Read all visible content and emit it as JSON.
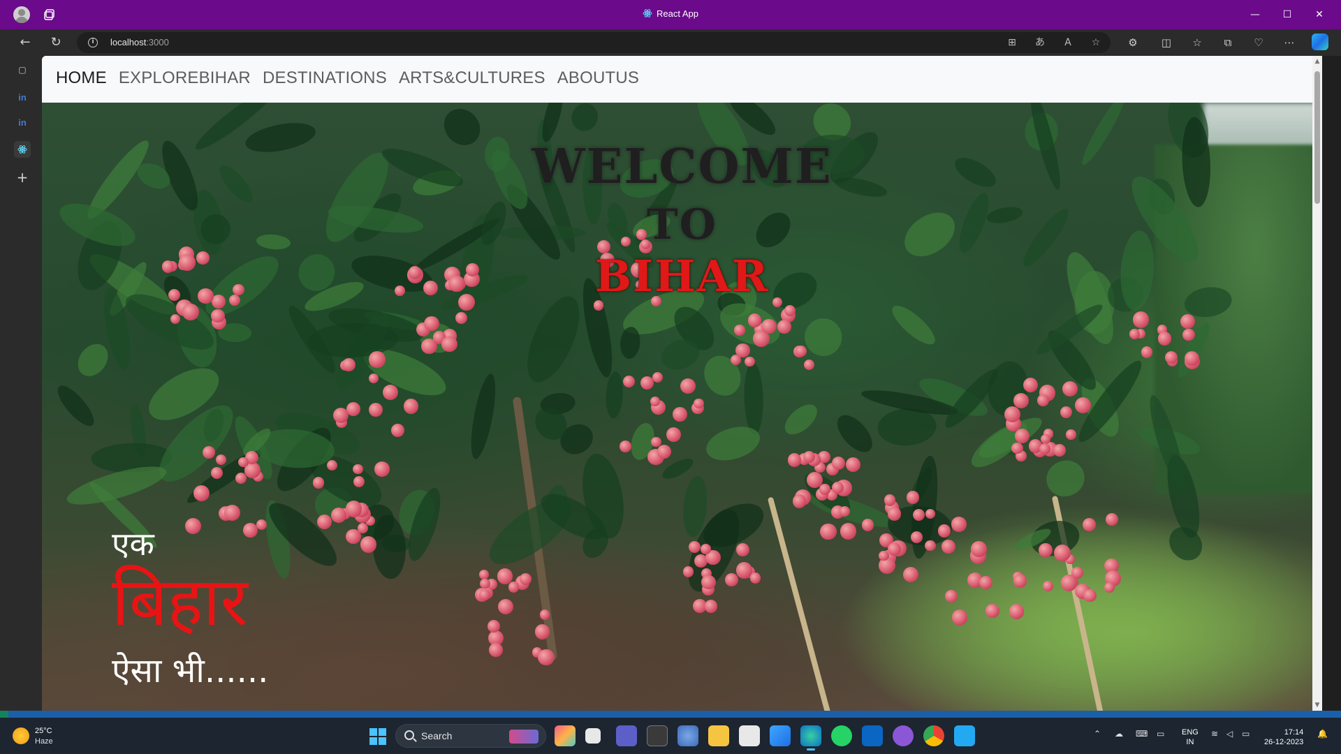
{
  "window": {
    "title": "React App",
    "controls": {
      "minimize": "—",
      "maximize": "☐",
      "close": "✕"
    }
  },
  "addressbar": {
    "url_host": "localhost",
    "url_port": ":3000"
  },
  "page": {
    "nav": {
      "items": [
        {
          "label": "HOME",
          "active": true
        },
        {
          "label": "EXPLOREBIHAR",
          "active": false
        },
        {
          "label": "DESTINATIONS",
          "active": false
        },
        {
          "label": "ARTS&CULTURES",
          "active": false
        },
        {
          "label": "ABOUTUS",
          "active": false
        }
      ]
    },
    "hero": {
      "welcome": "WELCOME",
      "to": "TO",
      "state": "BIHAR",
      "hindi_line1": "एक",
      "hindi_line2": "बिहार",
      "hindi_line3": "ऐसा भी......"
    }
  },
  "taskbar": {
    "weather": {
      "temp": "25°C",
      "condition": "Haze"
    },
    "search_label": "Search",
    "language": {
      "line1": "ENG",
      "line2": "IN"
    },
    "clock": {
      "time": "17:14",
      "date": "26-12-2023"
    }
  },
  "colors": {
    "titlebar": "#6b0a8b",
    "accent_red": "#e01818",
    "taskbar": "#1c2530"
  }
}
